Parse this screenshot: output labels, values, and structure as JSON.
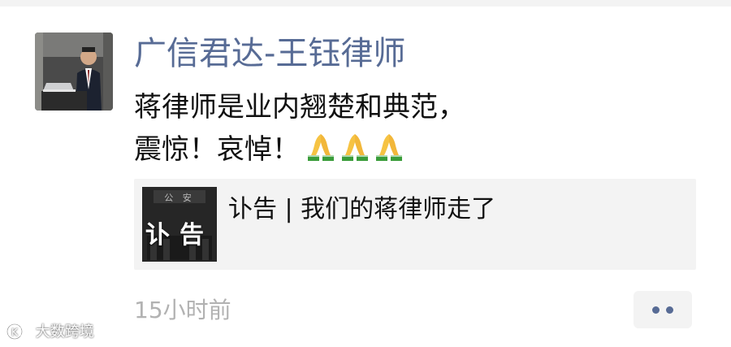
{
  "post": {
    "author": "广信君达-王钰律师",
    "text_line1": "蒋律师是业内翘楚和典范，",
    "text_line2": "震惊！哀悼！",
    "emoji": "folded-hands-emoji"
  },
  "share_card": {
    "thumbnail_label": "讣告",
    "thumbnail_banner": "公 安",
    "title": "讣告 | 我们的蒋律师走了"
  },
  "meta": {
    "timestamp": "15小时前"
  },
  "watermark": {
    "text": "大数跨境",
    "logo_text": "K"
  },
  "colors": {
    "link_blue": "#576b95",
    "timestamp_gray": "#b2b2b2",
    "card_bg": "#f3f3f3"
  }
}
